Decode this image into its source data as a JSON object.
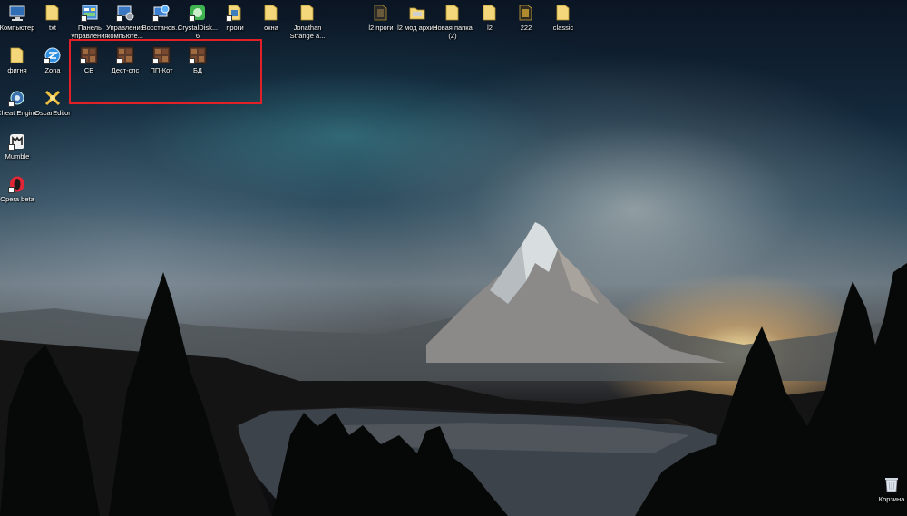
{
  "desktop": {
    "wallpaper": "mountain-lake-sunset",
    "accent_color": "#e12127",
    "icons": [
      {
        "label": "Компьютер",
        "icon": "computer-icon"
      },
      {
        "label": "txt",
        "icon": "folder-icon"
      },
      {
        "label": "Панель управления",
        "icon": "control-panel-icon"
      },
      {
        "label": "Управление компьюте...",
        "icon": "computer-management-icon"
      },
      {
        "label": "Восстанов...",
        "icon": "restore-icon"
      },
      {
        "label": "CrystalDisk... 6",
        "icon": "crystaldisk-icon"
      },
      {
        "label": "проги",
        "icon": "folder-icon"
      },
      {
        "label": "окна",
        "icon": "folder-icon"
      },
      {
        "label": "Jonathan Strange a...",
        "icon": "folder-icon"
      },
      {
        "label": "l2 проги",
        "icon": "folder-icon"
      },
      {
        "label": "l2 мод архив",
        "icon": "folder-icon"
      },
      {
        "label": "Новая папка (2)",
        "icon": "folder-icon"
      },
      {
        "label": "l2",
        "icon": "folder-icon"
      },
      {
        "label": "222",
        "icon": "folder-icon"
      },
      {
        "label": "classic",
        "icon": "folder-icon"
      },
      {
        "label": "фигня",
        "icon": "folder-icon"
      },
      {
        "label": "Zona",
        "icon": "zona-icon"
      },
      {
        "label": "СБ",
        "icon": "game-shortcut-icon"
      },
      {
        "label": "Дест-спс",
        "icon": "game-shortcut-icon"
      },
      {
        "label": "ПП-Кот",
        "icon": "game-shortcut-icon"
      },
      {
        "label": "БД",
        "icon": "game-shortcut-icon"
      },
      {
        "label": "Cheat Engine",
        "icon": "cheat-engine-icon"
      },
      {
        "label": "OscarEditor",
        "icon": "oscar-editor-icon"
      },
      {
        "label": "Mumble",
        "icon": "mumble-icon"
      },
      {
        "label": "Opera beta",
        "icon": "opera-icon"
      },
      {
        "label": "Корзина",
        "icon": "recycle-bin-icon"
      }
    ]
  }
}
